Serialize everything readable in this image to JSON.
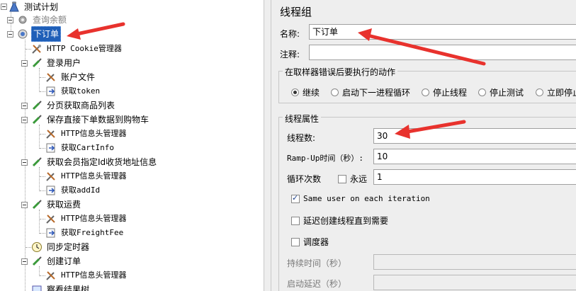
{
  "tree": {
    "root": "测试计划",
    "nodes": [
      {
        "label": "查询余额",
        "disabled": true
      },
      {
        "label": "下订单",
        "selected": true
      },
      {
        "label": "HTTP Cookie管理器"
      },
      {
        "label": "登录用户"
      },
      {
        "label": "账户文件"
      },
      {
        "label": "获取token"
      },
      {
        "label": "分页获取商品列表"
      },
      {
        "label": "保存直接下单数据到购物车"
      },
      {
        "label": "HTTP信息头管理器"
      },
      {
        "label": "获取CartInfo"
      },
      {
        "label": "获取会员指定Id收货地址信息"
      },
      {
        "label": "HTTP信息头管理器"
      },
      {
        "label": "获取addId"
      },
      {
        "label": "获取运费"
      },
      {
        "label": "HTTP信息头管理器"
      },
      {
        "label": "获取FreightFee"
      },
      {
        "label": "同步定时器"
      },
      {
        "label": "创建订单"
      },
      {
        "label": "HTTP信息头管理器"
      },
      {
        "label": "察看结果树"
      }
    ]
  },
  "panel": {
    "title": "线程组",
    "name_label": "名称:",
    "name_value": "下订单",
    "comment_label": "注释:",
    "comment_value": "",
    "error_group_title": "在取样器错误后要执行的动作",
    "error_actions": [
      {
        "label": "继续",
        "selected": true
      },
      {
        "label": "启动下一进程循环",
        "selected": false
      },
      {
        "label": "停止线程",
        "selected": false
      },
      {
        "label": "停止测试",
        "selected": false
      },
      {
        "label": "立即停止",
        "selected": false
      }
    ],
    "props_group_title": "线程属性",
    "threads_label": "线程数:",
    "threads_value": "30",
    "rampup_label": "Ramp-Up时间（秒）:",
    "rampup_value": "10",
    "loop_label": "循环次数",
    "forever_label": "永远",
    "loop_value": "1",
    "same_user_label": "Same user on each iteration",
    "same_user_checked": true,
    "delay_label": "延迟创建线程直到需要",
    "delay_checked": false,
    "scheduler_label": "调度器",
    "scheduler_checked": false,
    "duration_label": "持续时间（秒）",
    "startup_delay_label": "启动延迟（秒）"
  },
  "colors": {
    "selection": "#1f5fb8",
    "annotation_arrow": "#e8322d",
    "panel_bg": "#eeeeee"
  }
}
